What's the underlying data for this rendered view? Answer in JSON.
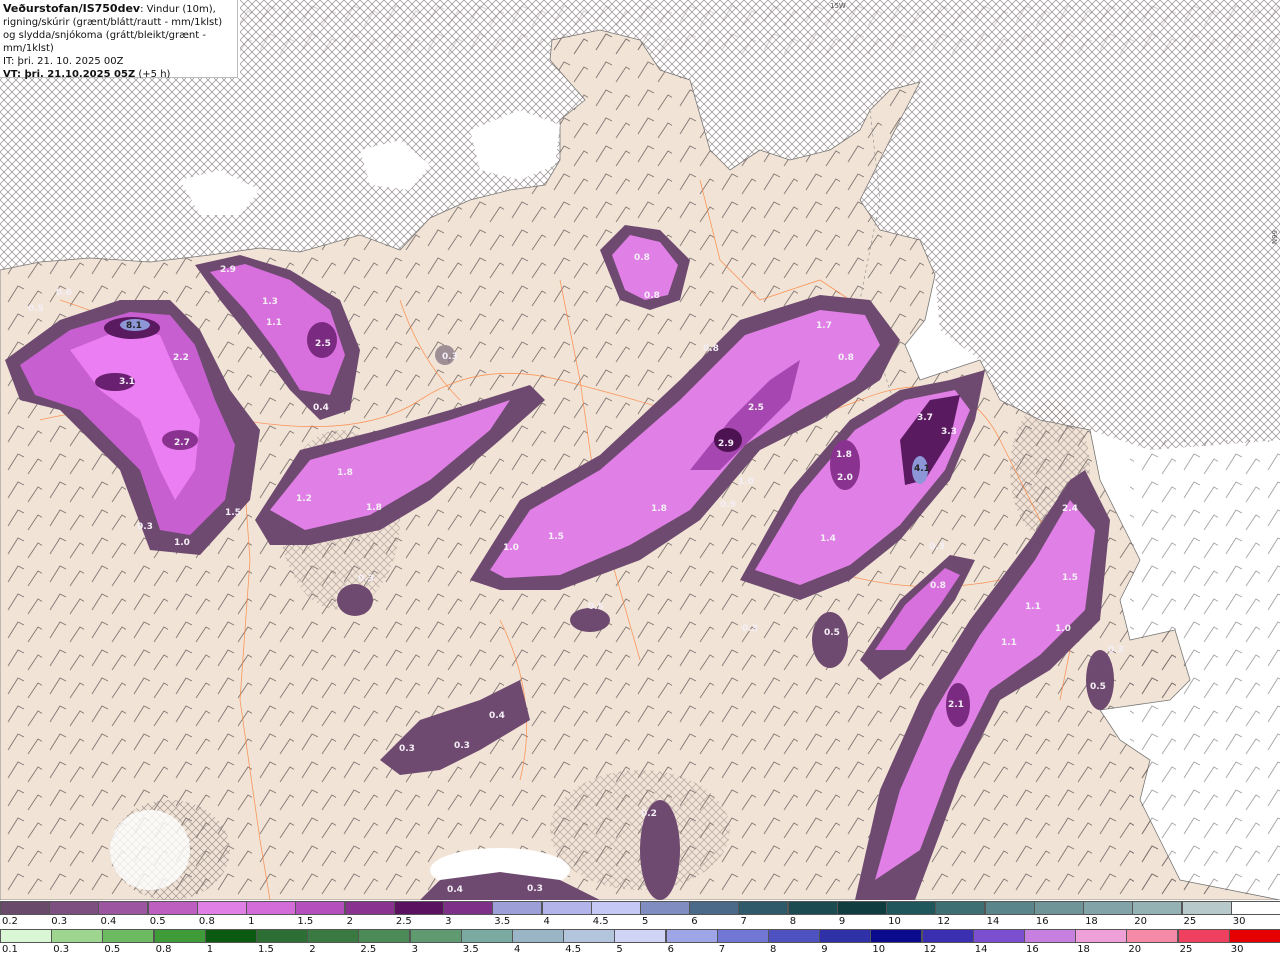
{
  "header": {
    "brand": "Veðurstofan/IS750dev",
    "description": ": Vindur (10m), rigning/skúrir (grænt/blátt/rautt - mm/1klst) og slydda/snjókoma (grátt/bleikt/grænt - mm/1klst)",
    "it_line": "IT: þri. 21. 10. 2025 00Z",
    "vt_label": "VT: þri. 21.10.2025 05Z",
    "vt_offset": "(+5 h)"
  },
  "map_labels": {
    "top_edge": "15W",
    "right_edge": "66N"
  },
  "precip_labels": [
    {
      "text": "0.5"
    },
    {
      "text": "0.6"
    },
    {
      "text": "2.9"
    },
    {
      "text": "8.1"
    },
    {
      "text": "1.3"
    },
    {
      "text": "1.1"
    },
    {
      "text": "2.5"
    },
    {
      "text": "2.2"
    },
    {
      "text": "3.1"
    },
    {
      "text": "0.4"
    },
    {
      "text": "0.3"
    },
    {
      "text": "0.8"
    },
    {
      "text": "0.8"
    },
    {
      "text": "1.7"
    },
    {
      "text": "0.8"
    },
    {
      "text": "0.8"
    },
    {
      "text": "2.7"
    },
    {
      "text": "1.8"
    },
    {
      "text": "1.2"
    },
    {
      "text": "1.5"
    },
    {
      "text": "1.8"
    },
    {
      "text": "0.3"
    },
    {
      "text": "1.0"
    },
    {
      "text": "2.5"
    },
    {
      "text": "2.9"
    },
    {
      "text": "1.0"
    },
    {
      "text": "1.8"
    },
    {
      "text": "0.9"
    },
    {
      "text": "1.5"
    },
    {
      "text": "1.0"
    },
    {
      "text": "3.7"
    },
    {
      "text": "3.3"
    },
    {
      "text": "1.8"
    },
    {
      "text": "2.0"
    },
    {
      "text": "4.1"
    },
    {
      "text": "1.4"
    },
    {
      "text": "0.3"
    },
    {
      "text": "0.8"
    },
    {
      "text": "0.3"
    },
    {
      "text": "0.5"
    },
    {
      "text": "0.3"
    },
    {
      "text": "0.5"
    },
    {
      "text": "2.4"
    },
    {
      "text": "1.5"
    },
    {
      "text": "1.1"
    },
    {
      "text": "1.1"
    },
    {
      "text": "1.0"
    },
    {
      "text": "0.3"
    },
    {
      "text": "0.5"
    },
    {
      "text": "2.1"
    },
    {
      "text": "0.4"
    },
    {
      "text": "0.3"
    },
    {
      "text": "0.3"
    },
    {
      "text": "0.2"
    },
    {
      "text": "0.4"
    },
    {
      "text": "0.3"
    }
  ],
  "legend_snow": {
    "labels": [
      "0.2",
      "0.3",
      "0.4",
      "0.5",
      "0.8",
      "1",
      "1.5",
      "2",
      "2.5",
      "3",
      "3.5",
      "4",
      "4.5",
      "5",
      "6",
      "7",
      "8",
      "9",
      "10",
      "12",
      "14",
      "16",
      "18",
      "20",
      "25",
      "30"
    ],
    "colors": [
      "#6a4a6a",
      "#7d4f80",
      "#9c55a0",
      "#bd5fc0",
      "#e07fe6",
      "#d36bd9",
      "#b54fbd",
      "#8a3290",
      "#5a1260",
      "#7e2f88",
      "#9da0d8",
      "#b3b5ea",
      "#c5c7f5",
      "#7f8dc0",
      "#4b6a8a",
      "#2f5a6a",
      "#1d4b52",
      "#0f3d40",
      "#20575c",
      "#3d6f73",
      "#5a858a",
      "#6f9599",
      "#82a3a7",
      "#94b1b4",
      "#b7c9cb",
      "#ffffff"
    ]
  },
  "legend_rain": {
    "labels": [
      "0.1",
      "0.3",
      "0.5",
      "0.8",
      "1",
      "1.5",
      "2",
      "2.5",
      "3",
      "3.5",
      "4",
      "4.5",
      "5",
      "6",
      "7",
      "8",
      "9",
      "10",
      "12",
      "14",
      "16",
      "18",
      "20",
      "25",
      "30"
    ],
    "colors": [
      "#d9f7d4",
      "#9fd68f",
      "#6dbb60",
      "#3f9a38",
      "#0b5a12",
      "#2c6e34",
      "#3a7a42",
      "#4c8a58",
      "#5f9a70",
      "#7aaaa0",
      "#9ab6c6",
      "#b3c4dd",
      "#cfd4f6",
      "#9fa6e8",
      "#7277d6",
      "#4d52c0",
      "#2f31a8",
      "#0a0a8c",
      "#3a2fb0",
      "#7b4fd0",
      "#c77fe0",
      "#f0a0d8",
      "#f58aa8",
      "#f04060",
      "#e40000"
    ]
  },
  "colors": {
    "sea": "#ffffff",
    "land": "#f1e4d6",
    "road": "#ff7b33"
  }
}
